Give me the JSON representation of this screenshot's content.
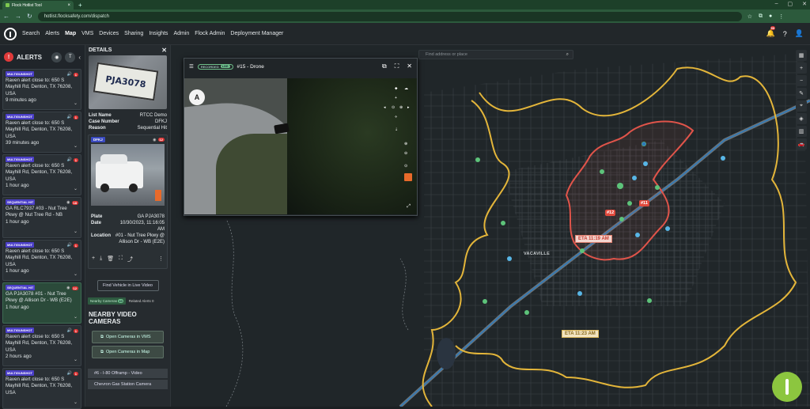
{
  "browser": {
    "tab_title": "Flock Hotlist Tool",
    "url": "hotlist.flocksafety.com/dispatch"
  },
  "nav": {
    "items": [
      "Search",
      "Alerts",
      "Map",
      "VMS",
      "Devices",
      "Sharing",
      "Insights",
      "Admin",
      "Flock Admin",
      "Deployment Manager"
    ],
    "active": "Map",
    "notif_count": "99"
  },
  "alerts": {
    "title": "ALERTS",
    "list": [
      {
        "badge": "MULTIGUNSHOT",
        "text": "Raven alert close to: 650 S Mayhill Rd, Denton, TX 76208, USA",
        "time": "9 minutes ago",
        "count": "1"
      },
      {
        "badge": "MULTIGUNSHOT",
        "text": "Raven alert close to: 650 S Mayhill Rd, Denton, TX 76208, USA",
        "time": "39 minutes ago",
        "count": "1"
      },
      {
        "badge": "MULTIGUNSHOT",
        "text": "Raven alert close to: 650 S Mayhill Rd, Denton, TX 76208, USA",
        "time": "1 hour ago",
        "count": "1"
      },
      {
        "badge": "SEQUENTIAL HIT",
        "text": "GA RLC7937 #03 - Nut Tree Pkwy @ Nut Tree Rd - NB",
        "time": "1 hour ago",
        "count": "18"
      },
      {
        "badge": "MULTIGUNSHOT",
        "text": "Raven alert close to: 650 S Mayhill Rd, Denton, TX 76208, USA",
        "time": "1 hour ago",
        "count": "1"
      },
      {
        "badge": "SEQUENTIAL HIT",
        "text": "GA PJA3078 #01 - Nut Tree Pkwy @ Allison Dr - WB (E2E)",
        "time": "1 hour ago",
        "count": "12"
      },
      {
        "badge": "MULTIGUNSHOT",
        "text": "Raven alert close to: 650 S Mayhill Rd, Denton, TX 76208, USA",
        "time": "2 hours ago",
        "count": "1"
      },
      {
        "badge": "MULTIGUNSHOT",
        "text": "Raven alert close to: 650 S Mayhill Rd, Denton, TX 76208, USA",
        "time": "",
        "count": "1"
      }
    ]
  },
  "details": {
    "title": "DETAILS",
    "plate_text": "PJA3078",
    "list_name_label": "List Name",
    "list_name": "RTCC Demo",
    "case_label": "Case Number",
    "case": "DFKJ",
    "reason_label": "Reason",
    "reason": "Sequential Hit",
    "card_badge": "DFKJ",
    "card_count": "12",
    "plate_label": "Plate",
    "plate": "GA PJA3078",
    "date_label": "Date",
    "date": "10/30/2023, 11:16:05 AM",
    "location_label": "Location",
    "location": "#01 - Nut Tree Pkwy @ Allison Dr - WB (E2E)",
    "find_vehicle": "Find Vehicle in Live Video",
    "tab_nearby": "Nearby Cameras",
    "tab_nearby_count": "10",
    "tab_related": "Related Alerts",
    "tab_related_count": "0",
    "nearby_title": "NEARBY VIDEO CAMERAS",
    "open_vms": "Open Cameras in VMS",
    "open_map": "Open Cameras in Map",
    "cameras": [
      "#6 - I-80 Offramp - Video",
      "Chevron Gas Station Camera"
    ]
  },
  "drone": {
    "recorded": "RECORDED",
    "live": "LIVE",
    "title": "#15 - Drone"
  },
  "map": {
    "search_placeholder": "Find address or place",
    "town": "VACAVILLE",
    "eta1": "ETA 11:19 AM",
    "eta2": "ETA 11:23 AM",
    "marker1": "#12",
    "marker2": "#11",
    "place": "Vacaville"
  }
}
